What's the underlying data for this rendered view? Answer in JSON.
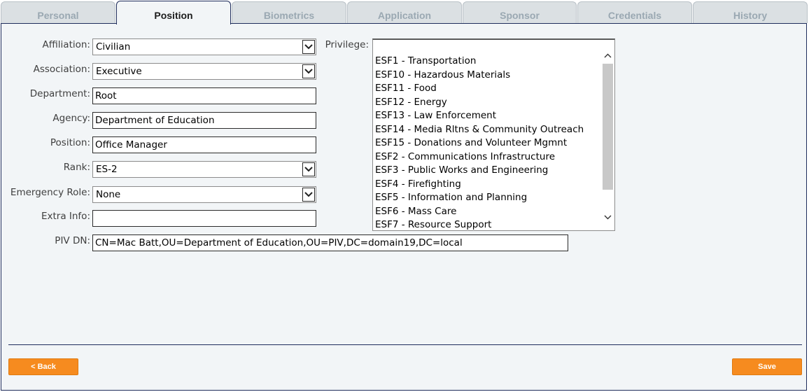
{
  "tabs": [
    "Personal",
    "Position",
    "Biometrics",
    "Application",
    "Sponsor",
    "Credentials",
    "History"
  ],
  "active_tab": "Position",
  "form": {
    "affiliation": {
      "label": "Affiliation:",
      "value": "Civilian"
    },
    "association": {
      "label": "Association:",
      "value": "Executive"
    },
    "department": {
      "label": "Department:",
      "value": "Root"
    },
    "agency": {
      "label": "Agency:",
      "value": "Department of Education"
    },
    "position": {
      "label": "Position:",
      "value": "Office Manager"
    },
    "rank": {
      "label": "Rank:",
      "value": "ES-2"
    },
    "emergency_role": {
      "label": "Emergency Role:",
      "value": "None"
    },
    "extra_info": {
      "label": "Extra Info:",
      "value": ""
    },
    "piv_dn": {
      "label": "PIV DN:",
      "value": "CN=Mac Batt,OU=Department of Education,OU=PIV,DC=domain19,DC=local"
    }
  },
  "privilege": {
    "label": "Privilege:",
    "items": [
      "ESF1 - Transportation",
      "ESF10 - Hazardous Materials",
      "ESF11 - Food",
      "ESF12 - Energy",
      "ESF13 - Law Enforcement",
      "ESF14 - Media Rltns & Community Outreach",
      "ESF15 - Donations and Volunteer Mgmnt",
      "ESF2 - Communications Infrastructure",
      "ESF3 - Public Works and Engineering",
      "ESF4 - Firefighting",
      "ESF5 - Information and Planning",
      "ESF6 - Mass Care",
      "ESF7 - Resource Support"
    ]
  },
  "buttons": {
    "back": "< Back",
    "save": "Save"
  },
  "colors": {
    "accent": "#f68b1f",
    "border": "#1f2d5c",
    "panel_bg": "#f2f5f7",
    "tab_bg": "#dbe0e3",
    "tab_text": "#9aa8b2"
  },
  "icons": {
    "dropdown": "chevron-down-icon",
    "scroll_up": "chevron-up-icon",
    "scroll_down": "chevron-down-icon"
  }
}
